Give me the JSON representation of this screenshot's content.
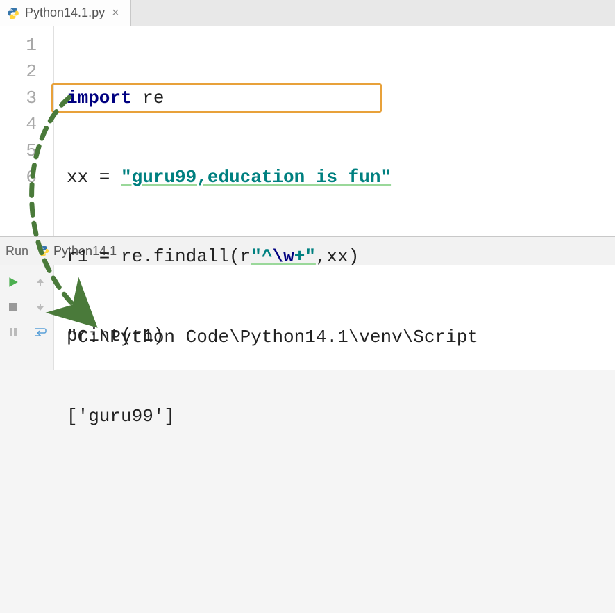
{
  "tab": {
    "filename": "Python14.1.py"
  },
  "gutter": [
    "1",
    "2",
    "3",
    "4",
    "5",
    "6"
  ],
  "code": {
    "l1": {
      "kw": "import",
      "mod": " re"
    },
    "l2": {
      "lhs": "xx = ",
      "str": "\"guru99,education is fun\""
    },
    "l3": {
      "lhs": "r1 = re.findall(",
      "pre": "r",
      "q1": "\"^",
      "esc": "\\w",
      "q2": "+\"",
      "rest": ",xx)"
    },
    "l4": {
      "fn": "print",
      "args": "(r1)"
    }
  },
  "run": {
    "label": "Run",
    "config": "Python14.1"
  },
  "output": {
    "line1": "\"C:\\Python Code\\Python14.1\\venv\\Script",
    "line2": "['guru99']"
  }
}
